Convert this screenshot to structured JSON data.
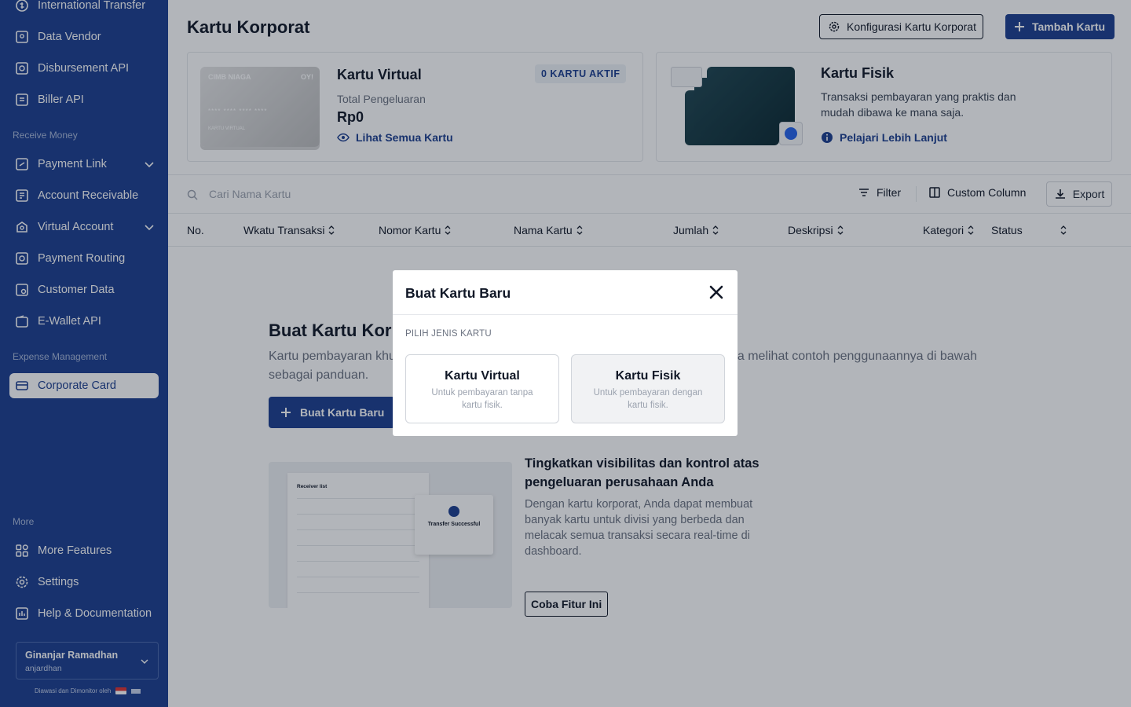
{
  "sidebar": {
    "items_top": [
      {
        "label": "International Transfer",
        "icon": "transfer-icon"
      },
      {
        "label": "Data Vendor",
        "icon": "vendor-icon"
      },
      {
        "label": "Disbursement API",
        "icon": "api-icon"
      },
      {
        "label": "Biller API",
        "icon": "biller-icon"
      }
    ],
    "section_receive": "Receive Money",
    "items_receive": [
      {
        "label": "Payment Link",
        "icon": "link-icon"
      },
      {
        "label": "Account Receivable",
        "icon": "receivable-icon"
      },
      {
        "label": "Virtual Account",
        "icon": "virtual-account-icon"
      },
      {
        "label": "Payment Routing",
        "icon": "routing-icon"
      },
      {
        "label": "Customer Data",
        "icon": "customer-icon"
      },
      {
        "label": "E-Wallet API",
        "icon": "wallet-icon"
      }
    ],
    "section_expense": "Expense Management",
    "active_item": {
      "label": "Corporate Card",
      "icon": "card-icon"
    },
    "section_more": "More",
    "items_more": [
      {
        "label": "More Features",
        "icon": "grid-icon"
      },
      {
        "label": "Settings",
        "icon": "gear-icon"
      },
      {
        "label": "Help & Documentation",
        "icon": "help-icon"
      }
    ],
    "user": {
      "name": "Ginanjar Ramadhan",
      "handle": "anjardhan"
    },
    "monitored_text": "Diawasi dan Dimonitor oleh"
  },
  "header": {
    "title": "Kartu Korporat",
    "config_button": "Konfigurasi Kartu Korporat",
    "add_button": "Tambah Kartu"
  },
  "virtual_panel": {
    "card_brand": "CIMB NIAGA",
    "card_brand2": "OY!",
    "card_number": "**** **** **** ****",
    "card_label": "KARTU VIRTUAL",
    "title": "Kartu Virtual",
    "badge": "0 KARTU AKTIF",
    "spend_label": "Total Pengeluaran",
    "spend_value": "Rp0",
    "link": "Lihat Semua Kartu"
  },
  "physical_panel": {
    "title": "Kartu Fisik",
    "desc": "Transaksi pembayaran yang praktis dan mudah dibawa ke mana saja.",
    "link": "Pelajari Lebih Lanjut"
  },
  "toolbar": {
    "search_placeholder": "Cari Nama Kartu",
    "filter": "Filter",
    "custom_column": "Custom Column",
    "export": "Export"
  },
  "table": {
    "headers": [
      "No.",
      "Wkatu Transaksi",
      "Nomor Kartu",
      "Nama Kartu",
      "Jumlah",
      "Deskripsi",
      "Kategori",
      "Status"
    ]
  },
  "empty_state": {
    "title": "Buat Kartu Korporat",
    "desc": "Kartu pembayaran khusus untuk kebutuhan operasional perusahaan Anda. Anda bisa melihat contoh penggunaannya di bawah sebagai panduan.",
    "button": "Buat Kartu Baru",
    "preview_title": "Receiver list",
    "preview_success": "Transfer Successful",
    "promo_title": "Tingkatkan visibilitas dan kontrol atas pengeluaran perusahaan Anda",
    "promo_desc": "Dengan kartu korporat, Anda dapat membuat banyak kartu untuk divisi yang berbeda dan melacak semua transaksi secara real-time di dashboard.",
    "promo_button": "Coba Fitur Ini"
  },
  "modal": {
    "title": "Buat Kartu Baru",
    "subtitle": "PILIH JENIS KARTU",
    "options": [
      {
        "title": "Kartu Virtual",
        "desc": "Untuk pembayaran tanpa kartu fisik."
      },
      {
        "title": "Kartu Fisik",
        "desc": "Untuk pembayaran dengan kartu fisik."
      }
    ]
  },
  "colors": {
    "brand": "#1c3f8f",
    "overlay": "rgba(17,24,39,0.32)"
  }
}
